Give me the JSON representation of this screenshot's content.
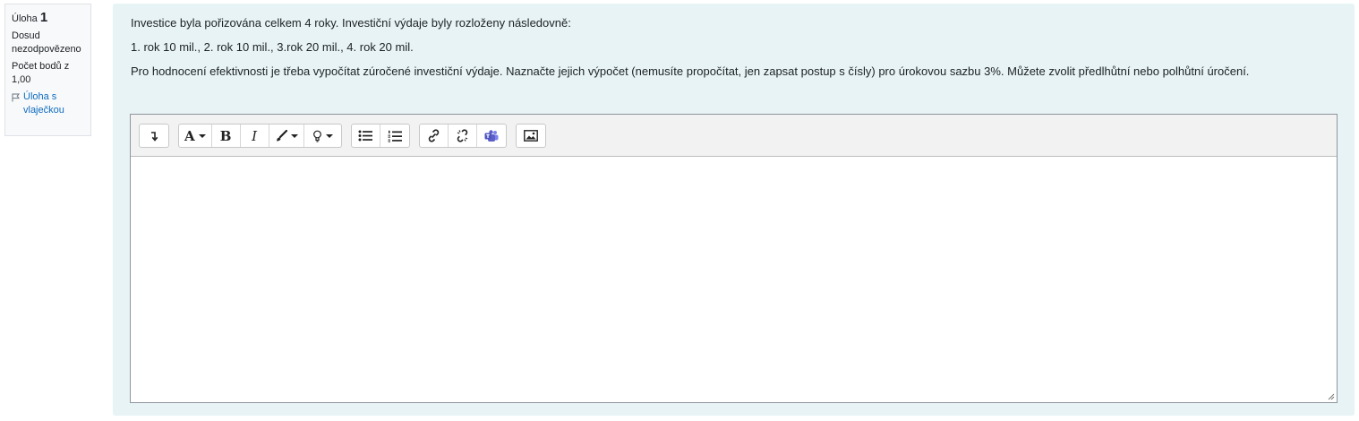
{
  "question_info": {
    "label": "Úloha",
    "number": "1",
    "state": "Dosud nezodpovězeno",
    "grade": "Počet bodů z 1,00",
    "flag_label": "Úloha s vlaječkou",
    "flag_icon": "flag-outline-icon"
  },
  "question": {
    "paragraphs": [
      "Investice byla pořizována celkem 4 roky. Investiční výdaje byly rozloženy následovně:",
      "1. rok 10 mil., 2. rok 10 mil., 3.rok 20 mil., 4. rok 20 mil.",
      "Pro hodnocení efektivnosti je třeba vypočítat zúročené investiční výdaje.  Naznačte jejich výpočet (nemusíte propočítat, jen zapsat postup s čísly) pro úrokovou sazbu 3%. Můžete zvolit předlhůtní nebo polhůtní úročení."
    ]
  },
  "editor": {
    "toolbar": {
      "collapse_icon": "arrow-down-icon",
      "font_glyph": "A",
      "bold_glyph": "B",
      "italic_glyph": "I",
      "style_icon": "paintbrush-icon",
      "accessibility_icon": "lightbulb-icon",
      "unordered_list_icon": "unordered-list-icon",
      "ordered_list_icon": "ordered-list-icon",
      "link_icon": "link-icon",
      "unlink_icon": "unlink-icon",
      "teams_icon": "teams-icon",
      "image_icon": "image-icon"
    },
    "value": "",
    "colors": {
      "teams": "#5b5fc7",
      "background": "#e7f3f5"
    }
  }
}
